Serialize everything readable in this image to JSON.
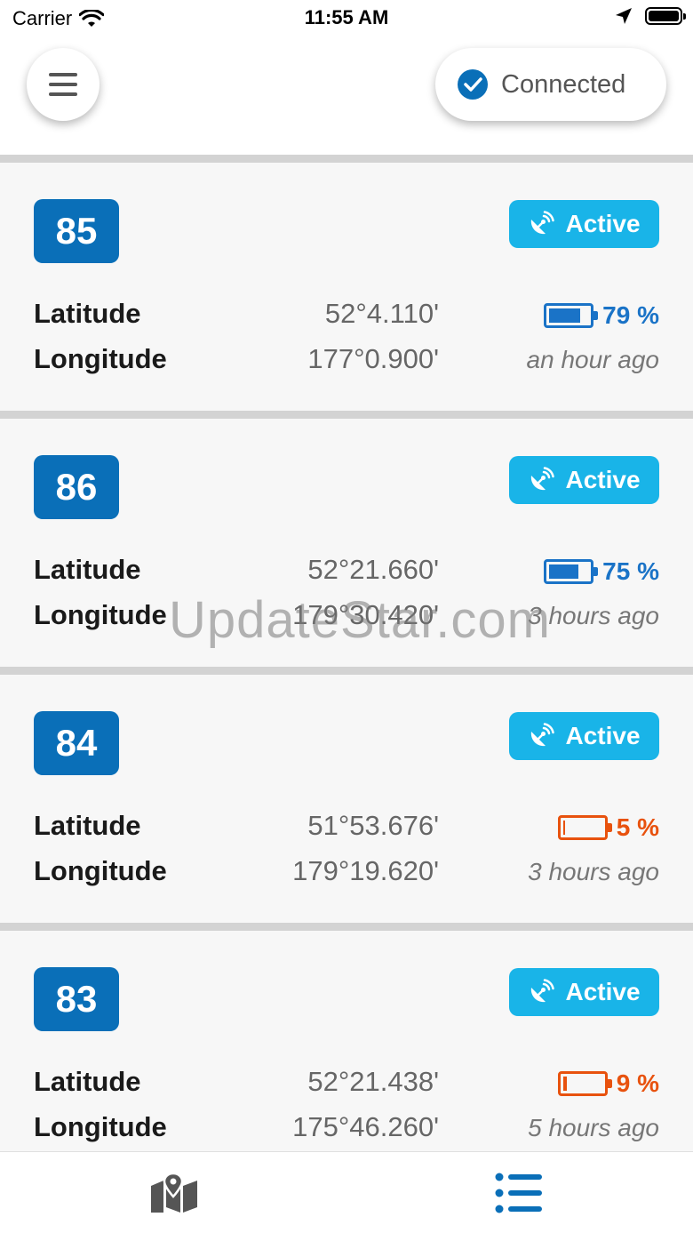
{
  "status_bar": {
    "carrier": "Carrier",
    "time": "11:55 AM"
  },
  "header": {
    "connection_label": "Connected"
  },
  "colors": {
    "primary": "#0a6fb8",
    "active_badge": "#19b4e8",
    "battery_ok": "#1a73c7",
    "battery_low": "#e8520e"
  },
  "devices": [
    {
      "id": "85",
      "status": "Active",
      "latitude_label": "Latitude",
      "longitude_label": "Longitude",
      "latitude": "52°4.110'",
      "longitude": "177°0.900'",
      "battery": "79 %",
      "battery_level": 79,
      "battery_state": "ok",
      "last_seen": "an hour ago"
    },
    {
      "id": "86",
      "status": "Active",
      "latitude_label": "Latitude",
      "longitude_label": "Longitude",
      "latitude": "52°21.660'",
      "longitude": "179°30.420'",
      "battery": "75 %",
      "battery_level": 75,
      "battery_state": "ok",
      "last_seen": "3 hours ago"
    },
    {
      "id": "84",
      "status": "Active",
      "latitude_label": "Latitude",
      "longitude_label": "Longitude",
      "latitude": "51°53.676'",
      "longitude": "179°19.620'",
      "battery": "5 %",
      "battery_level": 5,
      "battery_state": "low",
      "last_seen": "3 hours ago"
    },
    {
      "id": "83",
      "status": "Active",
      "latitude_label": "Latitude",
      "longitude_label": "Longitude",
      "latitude": "52°21.438'",
      "longitude": "175°46.260'",
      "battery": "9 %",
      "battery_level": 9,
      "battery_state": "low",
      "last_seen": "5 hours ago"
    }
  ],
  "watermark": "UpdateStar.com",
  "tab_bar": {
    "items": [
      {
        "icon": "map-pin-icon",
        "active": false
      },
      {
        "icon": "list-icon",
        "active": true
      }
    ]
  }
}
